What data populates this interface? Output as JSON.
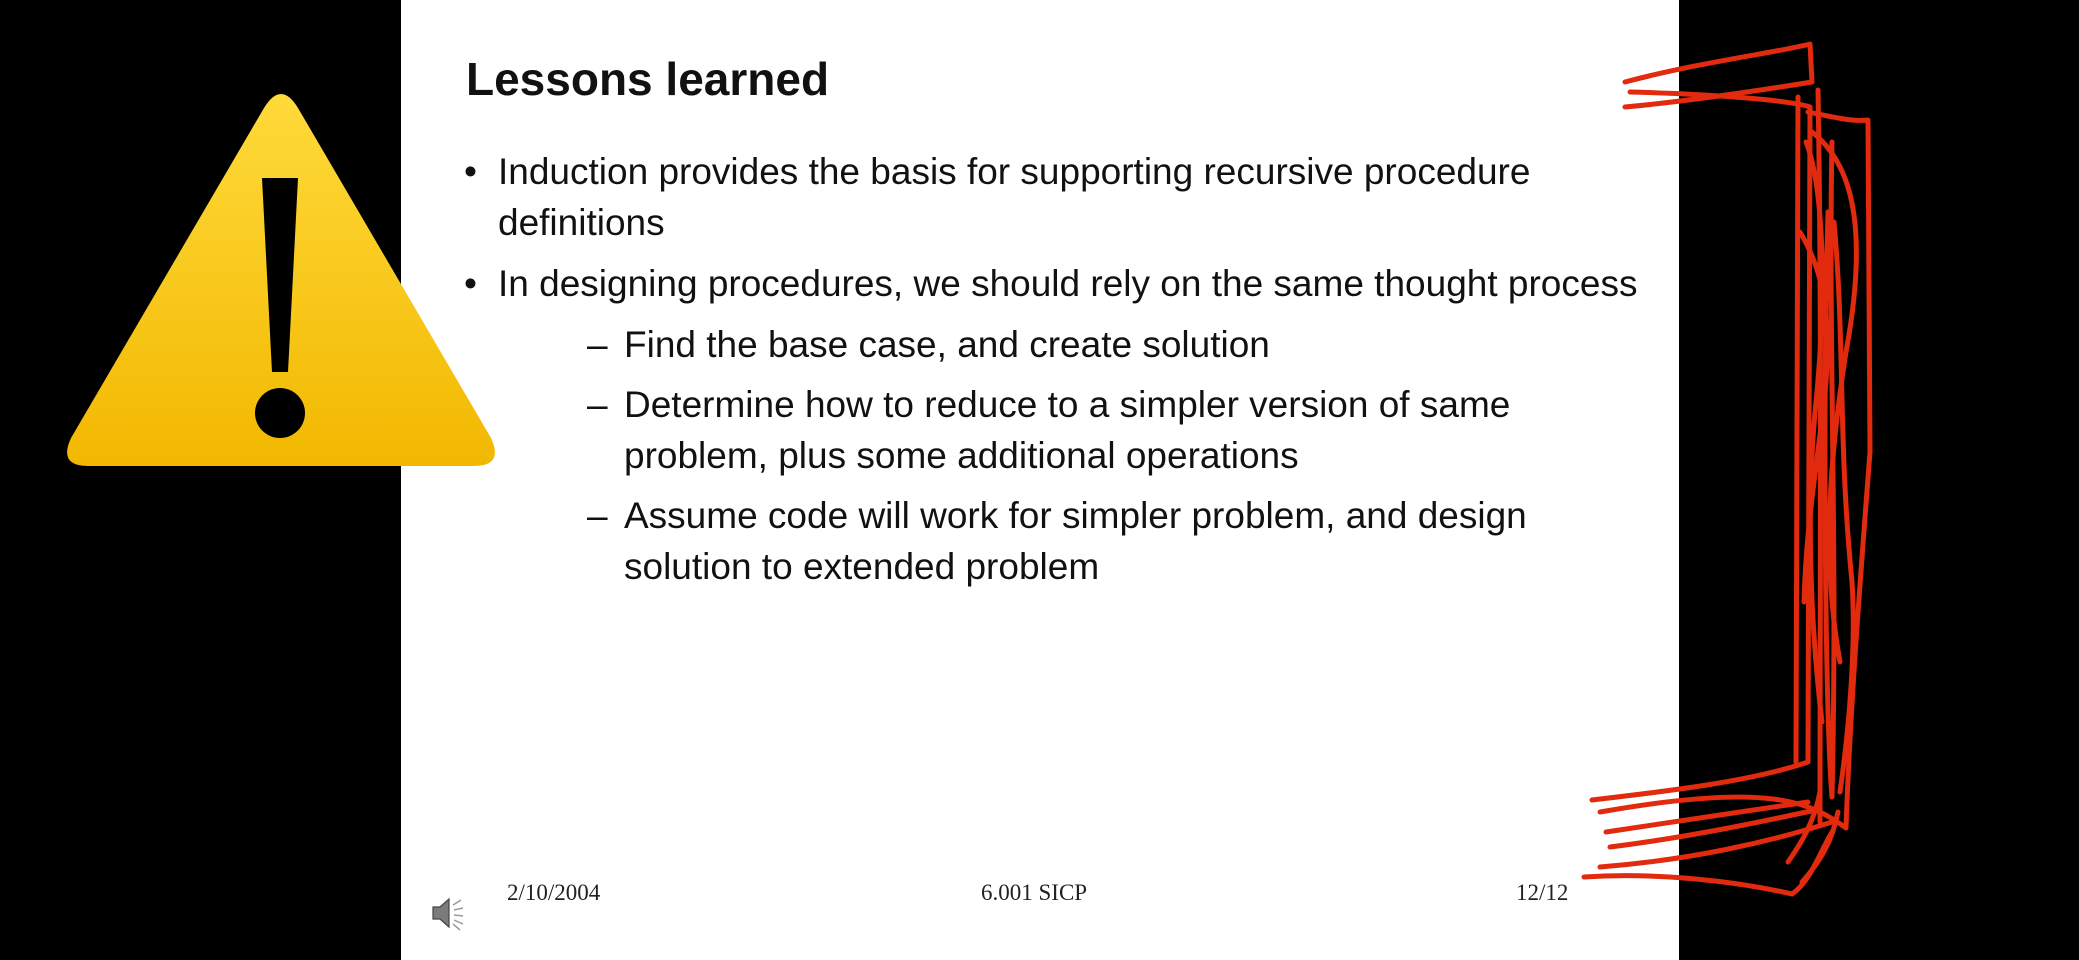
{
  "slide": {
    "title": "Lessons learned",
    "bullets": [
      {
        "level": 1,
        "marker": "•",
        "text": "Induction provides the basis for supporting recursive procedure definitions"
      },
      {
        "level": 1,
        "marker": "•",
        "text": "In designing procedures, we should rely on the same thought process"
      },
      {
        "level": 2,
        "marker": "–",
        "text": "Find the base case, and create solution"
      },
      {
        "level": 2,
        "marker": "–",
        "text": "Determine how to reduce to a simpler version of same problem, plus some additional operations"
      },
      {
        "level": 2,
        "marker": "–",
        "text": "Assume code will work for simpler problem, and design solution to extended problem"
      }
    ],
    "footer": {
      "date": "2/10/2004",
      "center": "6.001 SICP",
      "page": "12/12"
    }
  },
  "icons": {
    "warning": "warning-triangle-icon",
    "speaker": "speaker-icon"
  },
  "colors": {
    "background": "#000000",
    "slide": "#ffffff",
    "warning_fill": "#F7C200",
    "annotation_ink": "#E12A0E"
  }
}
